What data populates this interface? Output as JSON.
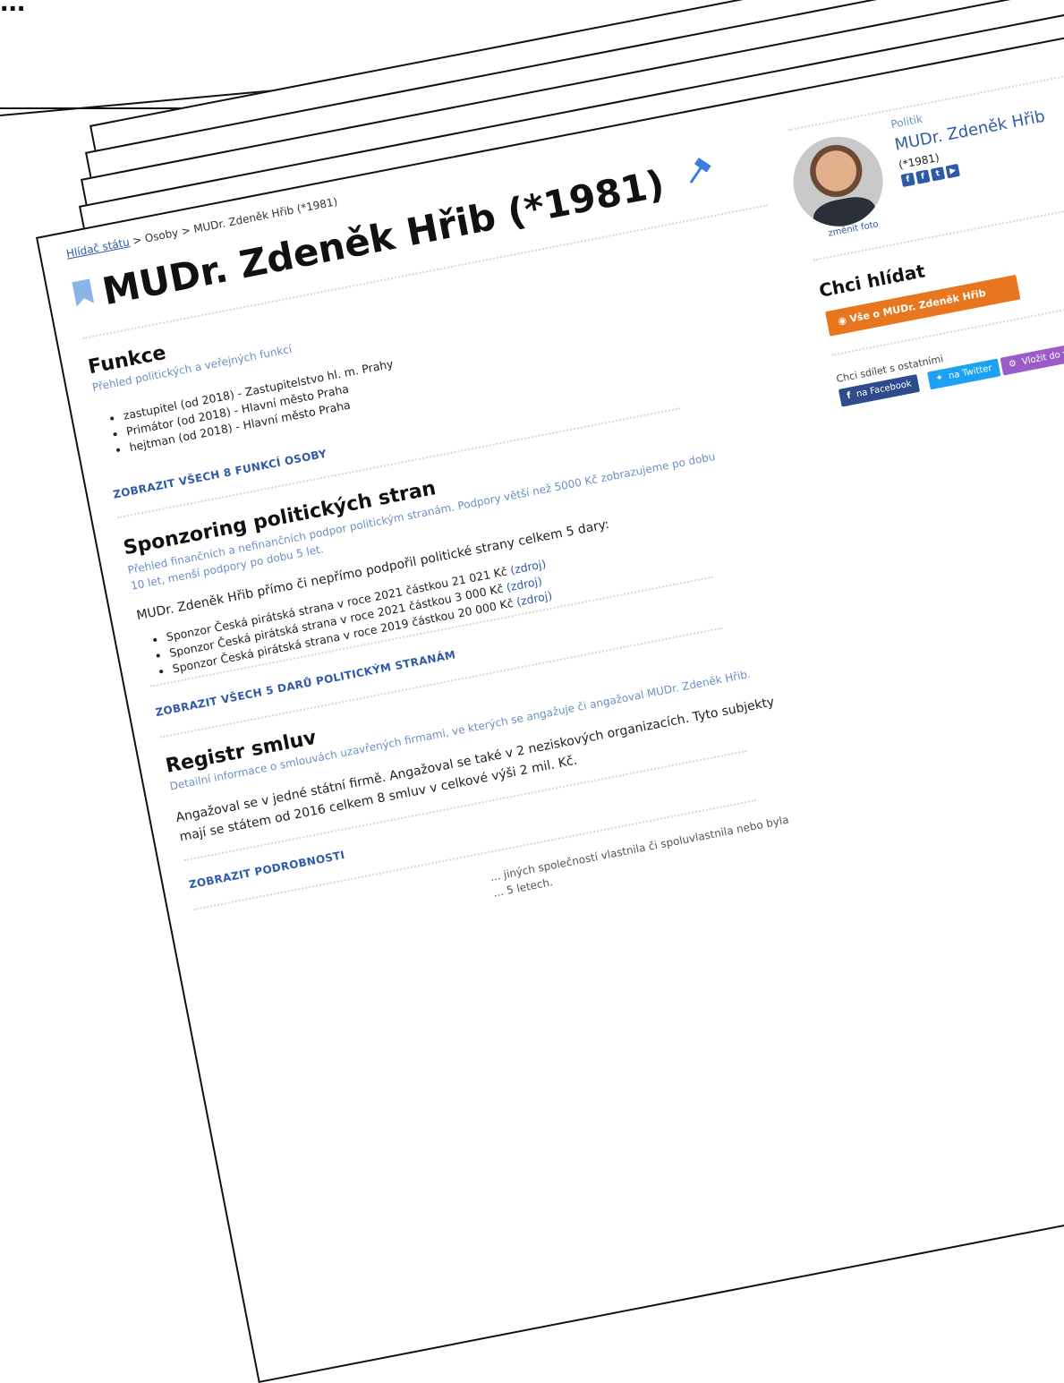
{
  "top_heading": "...",
  "breadcrumb": {
    "items": [
      "Hlídač státu",
      "Osoby",
      "MUDr. Zdeněk Hřib (*1981)"
    ],
    "separator": ">"
  },
  "page_title": "MUDr. Zdeněk Hřib (*1981)",
  "sections": {
    "funkce": {
      "title": "Funkce",
      "subtitle": "Přehled politických a veřejných funkcí",
      "items": [
        "zastupitel (od 2018) - Zastupitelstvo hl. m. Prahy",
        "Primátor (od 2018) - Hlavní město Praha",
        "hejtman (od 2018) - Hlavní město Praha"
      ],
      "cta": "ZOBRAZIT VŠECH 8 FUNKCÍ OSOBY"
    },
    "sponzoring": {
      "title": "Sponzoring politických stran",
      "subtitle_line1": "Přehled finančních a nefinančních podpor politickým stranám. Podpory větší než 5000 Kč zobrazujeme po dobu",
      "subtitle_line2": "10 let, menší podpory po dobu 5 let.",
      "summary": "MUDr. Zdeněk Hřib přímo či nepřímo podpořil politické strany celkem 5 dary:",
      "items": [
        {
          "text": "Sponzor Česká pirátská strana v roce 2021 částkou 21 021 Kč",
          "link": "(zdroj)"
        },
        {
          "text": "Sponzor Česká pirátská strana v roce 2021 částkou 3 000 Kč",
          "link": "(zdroj)"
        },
        {
          "text": "Sponzor Česká pirátská strana v roce 2019 částkou 20 000 Kč",
          "link": "(zdroj)"
        }
      ],
      "cta": "ZOBRAZIT VŠECH 5 DARŮ POLITICKÝM STRANÁM"
    },
    "registr": {
      "title": "Registr smluv",
      "subtitle": "Detailní informace o smlouvách uzavřených firmami, ve kterých se angažuje či angažoval MUDr. Zdeněk Hřib.",
      "line1": "Angažoval se v jedné státní firmě. Angažoval se také v 2 neziskových organizacích. Tyto subjekty",
      "line2": "mají se státem od 2016 celkem 8 smluv v celkové výši 2 mil. Kč.",
      "cta": "ZOBRAZIT PODROBNOSTI"
    },
    "next_partial": {
      "line1": "... jiných společností vlastnila či spoluvlastnila nebo byla",
      "line2": "... 5 letech."
    }
  },
  "sidebar": {
    "role": "Politik",
    "name": "MUDr. Zdeněk Hřib",
    "year": "(*1981)",
    "change_photo": "změnit foto",
    "watch_title": "Chci hlídat",
    "watch_button": "Vše o MUDr. Zdeněk Hřib",
    "share_label": "Chci sdílet s ostatními",
    "share_facebook": "na Facebook",
    "share_twitter": "na Twitter",
    "share_embed": "Vložit do vlastní stránky"
  },
  "colors": {
    "link": "#2f5aa8",
    "accent_orange": "#e8761e",
    "facebook": "#2d4c8c",
    "twitter": "#1da1f2",
    "embed": "#9b5cc9"
  }
}
